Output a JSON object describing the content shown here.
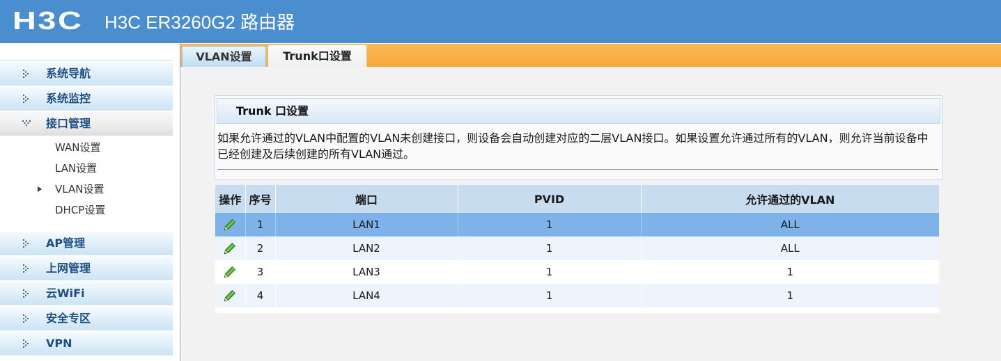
{
  "header": {
    "logo": "H3C",
    "title": "H3C ER3260G2 路由器"
  },
  "sidebar": {
    "menu": [
      {
        "label": "系统导航",
        "icon": "dotted-chevron-right-icon"
      },
      {
        "label": "系统监控",
        "icon": "dotted-chevron-right-icon"
      },
      {
        "label": "接口管理",
        "icon": "dotted-chevron-down-icon",
        "expanded": true,
        "submenu": [
          {
            "label": "WAN设置"
          },
          {
            "label": "LAN设置"
          },
          {
            "label": "VLAN设置",
            "current": true
          },
          {
            "label": "DHCP设置"
          }
        ]
      },
      {
        "label": "AP管理",
        "icon": "dotted-chevron-right-icon"
      },
      {
        "label": "上网管理",
        "icon": "dotted-chevron-right-icon"
      },
      {
        "label": "云WiFi",
        "icon": "dotted-chevron-right-icon"
      },
      {
        "label": "安全专区",
        "icon": "dotted-chevron-right-icon"
      },
      {
        "label": "VPN",
        "icon": "dotted-chevron-right-icon"
      }
    ]
  },
  "tabs": [
    {
      "label": "VLAN设置",
      "active": false
    },
    {
      "label": "Trunk口设置",
      "active": true
    }
  ],
  "panel": {
    "title": "Trunk 口设置",
    "description": "如果允许通过的VLAN中配置的VLAN未创建接口，则设备会自动创建对应的二层VLAN接口。如果设置允许通过所有的VLAN，则允许当前设备中已经创建及后续创建的所有VLAN通过。"
  },
  "table": {
    "columns": [
      "操作",
      "序号",
      "端口",
      "PVID",
      "允许通过的VLAN"
    ],
    "rows": [
      {
        "index": "1",
        "port": "LAN1",
        "pvid": "1",
        "allowed_vlan": "ALL",
        "selected": true,
        "action_icon": "edit-pencil-icon"
      },
      {
        "index": "2",
        "port": "LAN2",
        "pvid": "1",
        "allowed_vlan": "ALL",
        "selected": false,
        "action_icon": "edit-pencil-icon"
      },
      {
        "index": "3",
        "port": "LAN3",
        "pvid": "1",
        "allowed_vlan": "1",
        "selected": false,
        "action_icon": "edit-pencil-icon"
      },
      {
        "index": "4",
        "port": "LAN4",
        "pvid": "1",
        "allowed_vlan": "1",
        "selected": false,
        "action_icon": "edit-pencil-icon"
      }
    ]
  },
  "theme": {
    "header_bg": "#4a8ecf",
    "tab_bar": "#f6a73a",
    "table_header": "#c8dcf0",
    "selected_row": "#80b2ea",
    "menu_text": "#1d4f86"
  }
}
